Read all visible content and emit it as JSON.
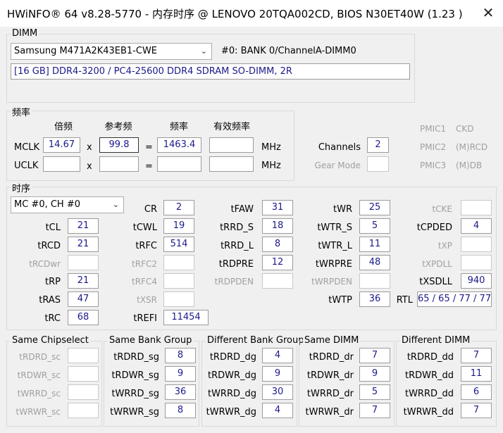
{
  "window": {
    "title": "HWiNFO® 64 v8.28-5770 - 内存时序 @ LENOVO 20TQA002CD, BIOS N30ET40W (1.23 )",
    "close_symbol": "✕"
  },
  "dimm": {
    "group_label": "DIMM",
    "module_selected": "Samsung M471A2K43EB1-CWE",
    "slot": "#0: BANK 0/ChannelA-DIMM0",
    "description": "[16 GB] DDR4-3200 / PC4-25600 DDR4 SDRAM SO-DIMM, 2R"
  },
  "freq": {
    "group_label": "频率",
    "headers": {
      "multiplier": "倍频",
      "ref": "参考频",
      "freq": "频率",
      "effective": "有效频率"
    },
    "mclk": {
      "label": "MCLK",
      "multiplier": "14.67",
      "ref": "99.8",
      "freq": "1463.4",
      "effective": ""
    },
    "uclk": {
      "label": "UCLK",
      "multiplier": "",
      "ref": "",
      "freq": "",
      "effective": ""
    },
    "op_x": "x",
    "op_eq": "=",
    "unit": "MHz",
    "channels": {
      "label": "Channels",
      "value": "2"
    },
    "gear_mode": {
      "label": "Gear Mode",
      "value": ""
    },
    "pmic": [
      {
        "label": "PMIC1",
        "value": "CKD"
      },
      {
        "label": "PMIC2",
        "value": "(M)RCD"
      },
      {
        "label": "PMIC3",
        "value": "(M)DB"
      }
    ]
  },
  "timing": {
    "group_label": "时序",
    "mc_selected": "MC #0, CH #0",
    "col1": [
      {
        "label": "tCL",
        "value": "21"
      },
      {
        "label": "tRCD",
        "value": "21"
      },
      {
        "label": "tRCDwr",
        "value": ""
      },
      {
        "label": "tRP",
        "value": "21"
      },
      {
        "label": "tRAS",
        "value": "47"
      },
      {
        "label": "tRC",
        "value": "68"
      }
    ],
    "col2": [
      {
        "label": "CR",
        "value": "2"
      },
      {
        "label": "tCWL",
        "value": "19"
      },
      {
        "label": "tRFC",
        "value": "514"
      },
      {
        "label": "tRFC2",
        "value": ""
      },
      {
        "label": "tRFC4",
        "value": ""
      },
      {
        "label": "tXSR",
        "value": ""
      },
      {
        "label": "tREFI",
        "value": "11454"
      }
    ],
    "col3": [
      {
        "label": "tFAW",
        "value": "31"
      },
      {
        "label": "tRRD_S",
        "value": "18"
      },
      {
        "label": "tRRD_L",
        "value": "8"
      },
      {
        "label": "tRDPRE",
        "value": "12"
      },
      {
        "label": "tRDPDEN",
        "value": ""
      }
    ],
    "col4": [
      {
        "label": "tWR",
        "value": "25"
      },
      {
        "label": "tWTR_S",
        "value": "5"
      },
      {
        "label": "tWTR_L",
        "value": "11"
      },
      {
        "label": "tWRPRE",
        "value": "48"
      },
      {
        "label": "tWRPDEN",
        "value": ""
      },
      {
        "label": "tWTP",
        "value": "36"
      }
    ],
    "col5": [
      {
        "label": "tCKE",
        "value": ""
      },
      {
        "label": "tCPDED",
        "value": "4"
      },
      {
        "label": "tXP",
        "value": ""
      },
      {
        "label": "tXPDLL",
        "value": ""
      },
      {
        "label": "tXSDLL",
        "value": "940"
      }
    ],
    "rtl": {
      "label": "RTL",
      "value": "65 / 65 / 77 / 77"
    }
  },
  "groups": {
    "same_chipselect": {
      "label": "Same Chipselect",
      "rows": [
        {
          "label": "tRDRD_sc",
          "value": ""
        },
        {
          "label": "tRDWR_sc",
          "value": ""
        },
        {
          "label": "tWRRD_sc",
          "value": ""
        },
        {
          "label": "tWRWR_sc",
          "value": ""
        }
      ]
    },
    "same_bank_group": {
      "label": "Same Bank Group",
      "rows": [
        {
          "label": "tRDRD_sg",
          "value": "8"
        },
        {
          "label": "tRDWR_sg",
          "value": "9"
        },
        {
          "label": "tWRRD_sg",
          "value": "36"
        },
        {
          "label": "tWRWR_sg",
          "value": "8"
        }
      ]
    },
    "different_bank_group": {
      "label": "Different Bank Group",
      "rows": [
        {
          "label": "tRDRD_dg",
          "value": "4"
        },
        {
          "label": "tRDWR_dg",
          "value": "9"
        },
        {
          "label": "tWRRD_dg",
          "value": "30"
        },
        {
          "label": "tWRWR_dg",
          "value": "4"
        }
      ]
    },
    "same_dimm": {
      "label": "Same DIMM",
      "rows": [
        {
          "label": "tRDRD_dr",
          "value": "7"
        },
        {
          "label": "tRDWR_dr",
          "value": "9"
        },
        {
          "label": "tWRRD_dr",
          "value": "5"
        },
        {
          "label": "tWRWR_dr",
          "value": "7"
        }
      ]
    },
    "different_dimm": {
      "label": "Different DIMM",
      "rows": [
        {
          "label": "tRDRD_dd",
          "value": "7"
        },
        {
          "label": "tRDWR_dd",
          "value": "11"
        },
        {
          "label": "tWRRD_dd",
          "value": "6"
        },
        {
          "label": "tWRWR_dd",
          "value": "7"
        }
      ]
    }
  }
}
